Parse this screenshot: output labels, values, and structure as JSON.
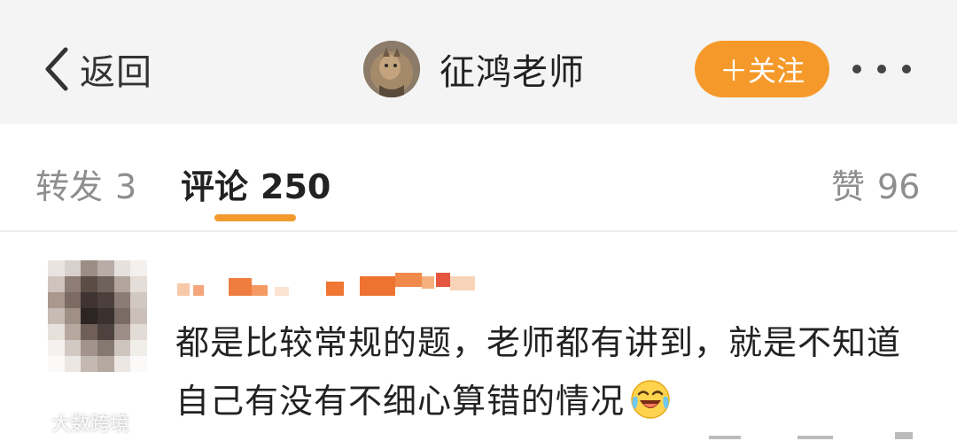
{
  "header": {
    "back_label": "返回",
    "profile_name": "征鸿老师",
    "follow_label": "＋关注"
  },
  "tabs": [
    {
      "label": "转发",
      "count": "3",
      "active": false
    },
    {
      "label": "评论",
      "count": "250",
      "active": true
    },
    {
      "label": "赞",
      "count": "96",
      "active": false
    }
  ],
  "comment": {
    "text": "都是比较常规的题，老师都有讲到，就是不知道自己有没有不细心算错的情况",
    "emoji": "laughing-crying-emoji"
  },
  "watermark": {
    "text": "大数跨境"
  },
  "colors": {
    "accent": "#f59a2a",
    "header_bg": "#f4f4f4",
    "inactive_tab": "#8e8e8e"
  }
}
